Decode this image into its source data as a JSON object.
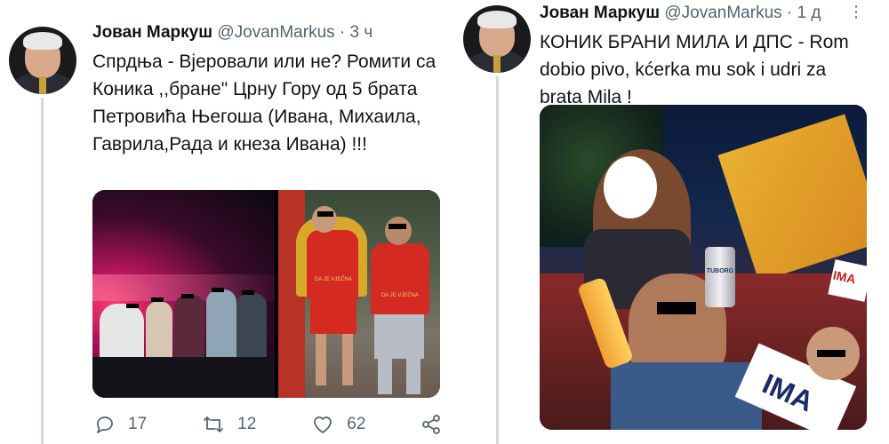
{
  "tweets": [
    {
      "name": "Јован Маркуш",
      "handle": "@JovanMarkus",
      "separator": "·",
      "time": "3 ч",
      "text": "Спрдња - Вјеровали или не? Ромити са Коника ,,бране\" Црну Гору од 5 брата Петровића Његоша (Ивана, Михаила, Гаврила,Рада и кнеза Ивана) !!!",
      "photo2_shirt_text": "DA JE VJEČNA",
      "actions": {
        "reply": "17",
        "retweet": "12",
        "like": "62"
      }
    },
    {
      "name": "Јован Маркуш",
      "handle": "@JovanMarkus",
      "separator": "·",
      "time": "1 д",
      "text": "КОНИК БРАНИ МИЛА И ДПС - Rom dobio pivo, kćerka mu sok i udri za brata Mila !",
      "can_label": "TUBORG",
      "sign_text": "IMA",
      "sign_small": "IMA"
    }
  ],
  "colors": {
    "text": "#0f1419",
    "secondary": "#536471",
    "thread": "#cfd9de"
  }
}
